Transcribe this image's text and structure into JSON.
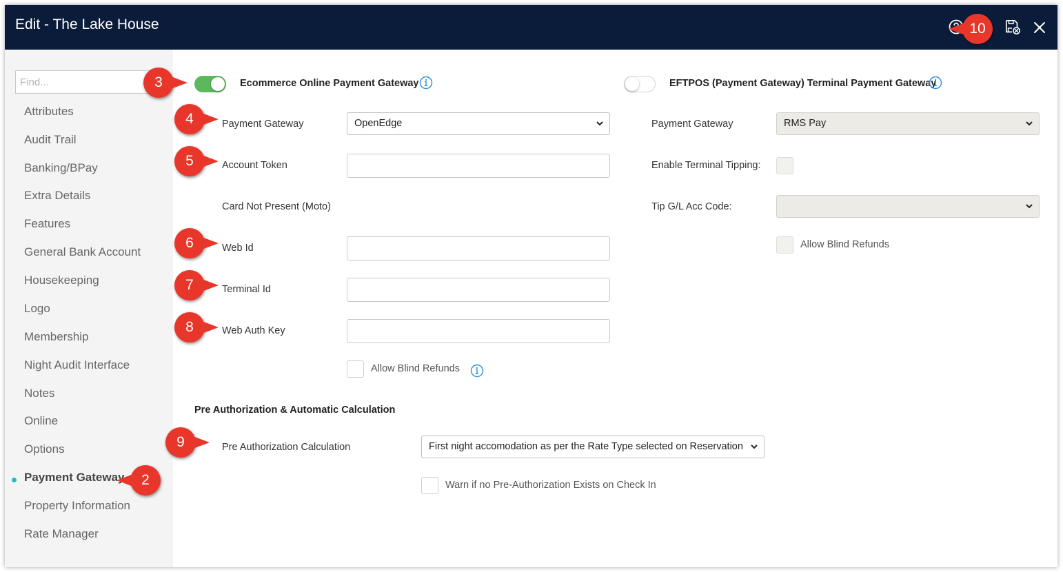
{
  "window": {
    "title": "Edit - The Lake House"
  },
  "toolbar": {
    "help_icon": "question-circle-icon",
    "save_icon": "save-close-icon",
    "close_icon": "close-icon"
  },
  "sidebar": {
    "find_placeholder": "Find...",
    "items": [
      {
        "label": "Attributes"
      },
      {
        "label": "Audit Trail"
      },
      {
        "label": "Banking/BPay"
      },
      {
        "label": "Extra Details"
      },
      {
        "label": "Features"
      },
      {
        "label": "General Bank Account"
      },
      {
        "label": "Housekeeping"
      },
      {
        "label": "Logo"
      },
      {
        "label": "Membership"
      },
      {
        "label": "Night Audit Interface"
      },
      {
        "label": "Notes"
      },
      {
        "label": "Online"
      },
      {
        "label": "Options"
      },
      {
        "label": "Payment Gateway",
        "active": true
      },
      {
        "label": "Property Information"
      },
      {
        "label": "Rate Manager"
      }
    ]
  },
  "ecommerce": {
    "title": "Ecommerce Online Payment Gateway",
    "enabled": true,
    "gateway_label": "Payment Gateway",
    "gateway_value": "OpenEdge",
    "account_token_label": "Account Token",
    "account_token_value": "",
    "card_not_present_label": "Card Not Present (Moto)",
    "web_id_label": "Web Id",
    "web_id_value": "",
    "terminal_id_label": "Terminal Id",
    "terminal_id_value": "",
    "web_auth_key_label": "Web Auth Key",
    "web_auth_key_value": "",
    "allow_blind_refunds_label": "Allow Blind Refunds",
    "allow_blind_refunds_checked": false
  },
  "eftpos": {
    "title": "EFTPOS (Payment Gateway) Terminal Payment Gateway",
    "enabled": false,
    "gateway_label": "Payment Gateway",
    "gateway_value": "RMS Pay",
    "tipping_label": "Enable Terminal Tipping:",
    "tipping_checked": false,
    "tip_gl_label": "Tip G/L Acc Code:",
    "tip_gl_value": "",
    "allow_blind_refunds_label": "Allow Blind Refunds",
    "allow_blind_refunds_checked": false
  },
  "preauth": {
    "section_title": "Pre Authorization & Automatic Calculation",
    "calc_label": "Pre Authorization Calculation",
    "calc_value": "First night accomodation as per the Rate Type selected on Reservation",
    "warn_label": "Warn if no Pre-Authorization Exists on Check In",
    "warn_checked": false
  },
  "callouts": {
    "c2": "2",
    "c3": "3",
    "c4": "4",
    "c5": "5",
    "c6": "6",
    "c7": "7",
    "c8": "8",
    "c9": "9",
    "c10": "10"
  },
  "colors": {
    "titlebar": "#0b1c3a",
    "toggle_on": "#5cb85c",
    "callout": "#e8362b",
    "active_dot": "#2cb5c0",
    "info_icon": "#2f8fd8"
  }
}
